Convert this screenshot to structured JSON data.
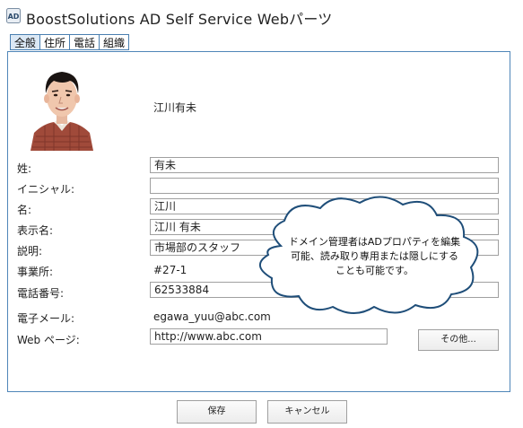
{
  "app": {
    "icon_name": "ad-app-icon",
    "title": "BoostSolutions AD Self Service Webパーツ"
  },
  "tabs": [
    {
      "label": "全般",
      "selected": true
    },
    {
      "label": "住所"
    },
    {
      "label": "電話"
    },
    {
      "label": "組織"
    }
  ],
  "profile": {
    "photo_icon": "user-photo",
    "display_name": "江川有未"
  },
  "fields": {
    "last_name": {
      "label": "姓:",
      "value": "有未"
    },
    "initials": {
      "label": "イニシャル:",
      "value": ""
    },
    "first_name": {
      "label": "名:",
      "value": "江川"
    },
    "display_name": {
      "label": "表示名:",
      "value": "江川 有未"
    },
    "description": {
      "label": "説明:",
      "value": "市場部のスタッフ"
    },
    "office": {
      "label": "事業所:",
      "value": "#27-1"
    },
    "phone": {
      "label": "電話番号:",
      "value": "62533884"
    },
    "email": {
      "label": "電子メール:",
      "value": "egawa_yuu@abc.com"
    },
    "web_page": {
      "label": "Web ページ:",
      "value": "http://www.abc.com"
    }
  },
  "buttons": {
    "other": "その他...",
    "save": "保存",
    "cancel": "キャンセル"
  },
  "callout": {
    "line1": "ドメイン管理者はADプロパティを編集",
    "line2": "可能、読み取り専用または隠しにする",
    "line3": "ことも可能です。"
  },
  "colors": {
    "panel_border": "#4f86b8",
    "tab_selected_bg": "#dbe8f5",
    "callout_fill": "#ffffff",
    "callout_border": "#1f4e79"
  }
}
